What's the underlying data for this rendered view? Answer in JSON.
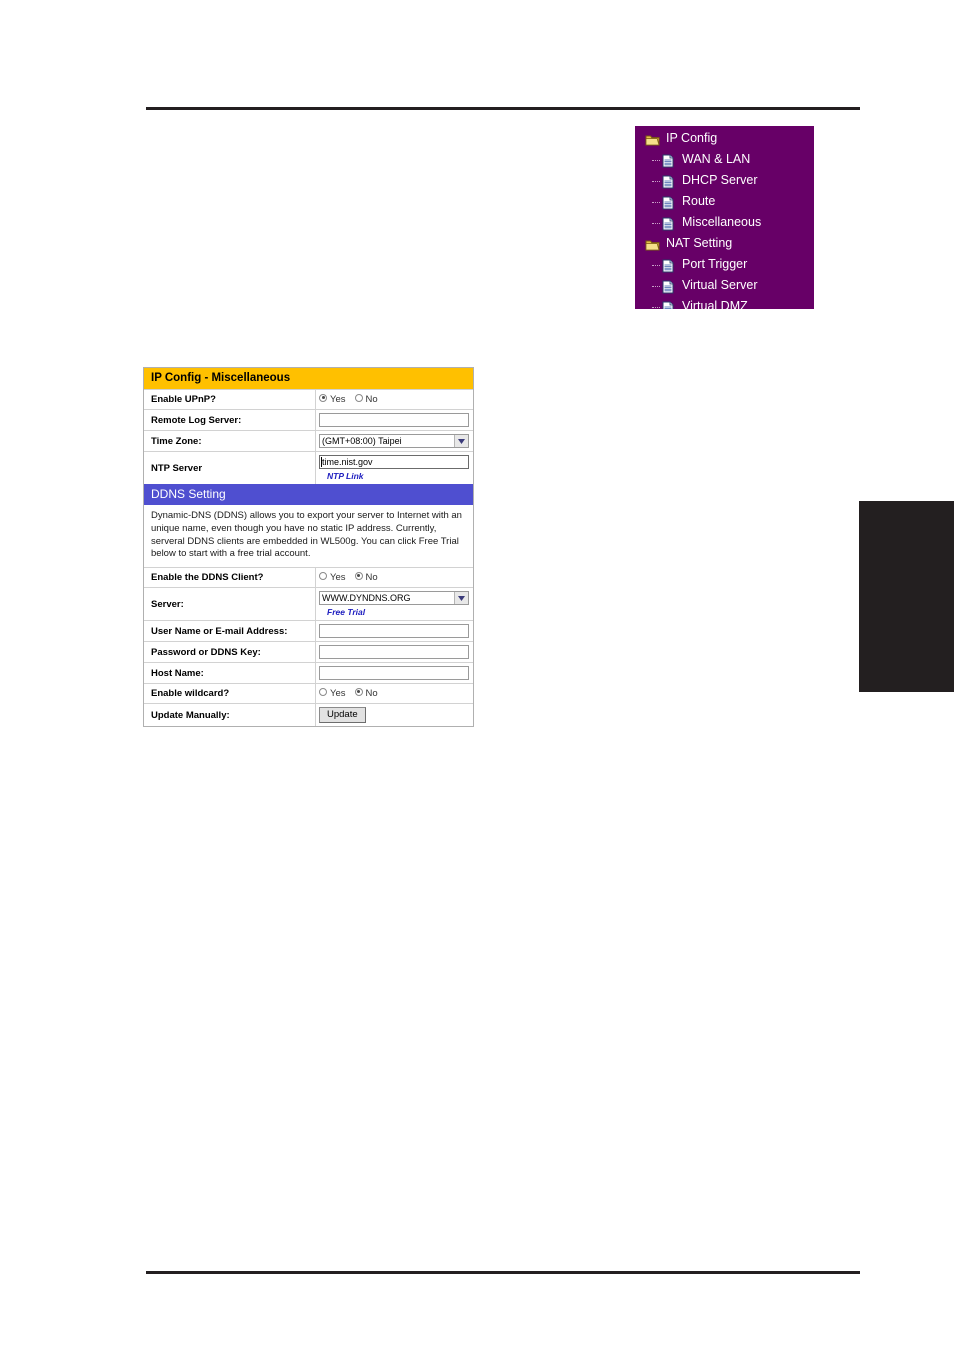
{
  "nav_panel": {
    "items": [
      {
        "label": "IP Config",
        "icon": "folder-icon",
        "level": 0
      },
      {
        "label": "WAN & LAN",
        "icon": "page-icon",
        "level": 1
      },
      {
        "label": "DHCP Server",
        "icon": "page-icon",
        "level": 1
      },
      {
        "label": "Route",
        "icon": "page-icon",
        "level": 1
      },
      {
        "label": "Miscellaneous",
        "icon": "page-icon",
        "level": 1
      },
      {
        "label": "NAT Setting",
        "icon": "folder-icon",
        "level": 0
      },
      {
        "label": "Port Trigger",
        "icon": "page-icon",
        "level": 1
      },
      {
        "label": "Virtual Server",
        "icon": "page-icon",
        "level": 1
      },
      {
        "label": "Virtual DMZ",
        "icon": "page-icon",
        "level": 1
      }
    ],
    "background_color": "#670067"
  },
  "config_form": {
    "main_header": "IP Config - Miscellaneous",
    "main_header_color": "#ffc000",
    "ddns_header": "DDNS Setting",
    "ddns_header_color": "#4f4fd0",
    "ddns_description": "Dynamic-DNS (DDNS) allows you to export your server to Internet with an unique name, even though you have no static IP address. Currently, serveral DDNS clients are embedded in WL500g. You can click Free Trial below to start with a free trial account.",
    "rows": {
      "enable_upnp": {
        "label": "Enable UPnP?",
        "yes_label": "Yes",
        "no_label": "No",
        "selected": "Yes"
      },
      "remote_log_server": {
        "label": "Remote Log Server:",
        "value": ""
      },
      "time_zone": {
        "label": "Time Zone:",
        "value": "(GMT+08:00) Taipei"
      },
      "ntp_server": {
        "label": "NTP Server",
        "value": "time.nist.gov",
        "link_label": "NTP Link"
      },
      "enable_ddns_client": {
        "label": "Enable the DDNS Client?",
        "yes_label": "Yes",
        "no_label": "No",
        "selected": "No"
      },
      "server": {
        "label": "Server:",
        "value": "WWW.DYNDNS.ORG",
        "link_label": "Free Trial"
      },
      "user_name": {
        "label": "User Name or E-mail Address:",
        "value": ""
      },
      "password": {
        "label": "Password or DDNS Key:",
        "value": ""
      },
      "host_name": {
        "label": "Host Name:",
        "value": ""
      },
      "enable_wildcard": {
        "label": "Enable wildcard?",
        "yes_label": "Yes",
        "no_label": "No",
        "selected": "No"
      },
      "update_manually": {
        "label": "Update Manually:",
        "button_label": "Update"
      }
    }
  }
}
